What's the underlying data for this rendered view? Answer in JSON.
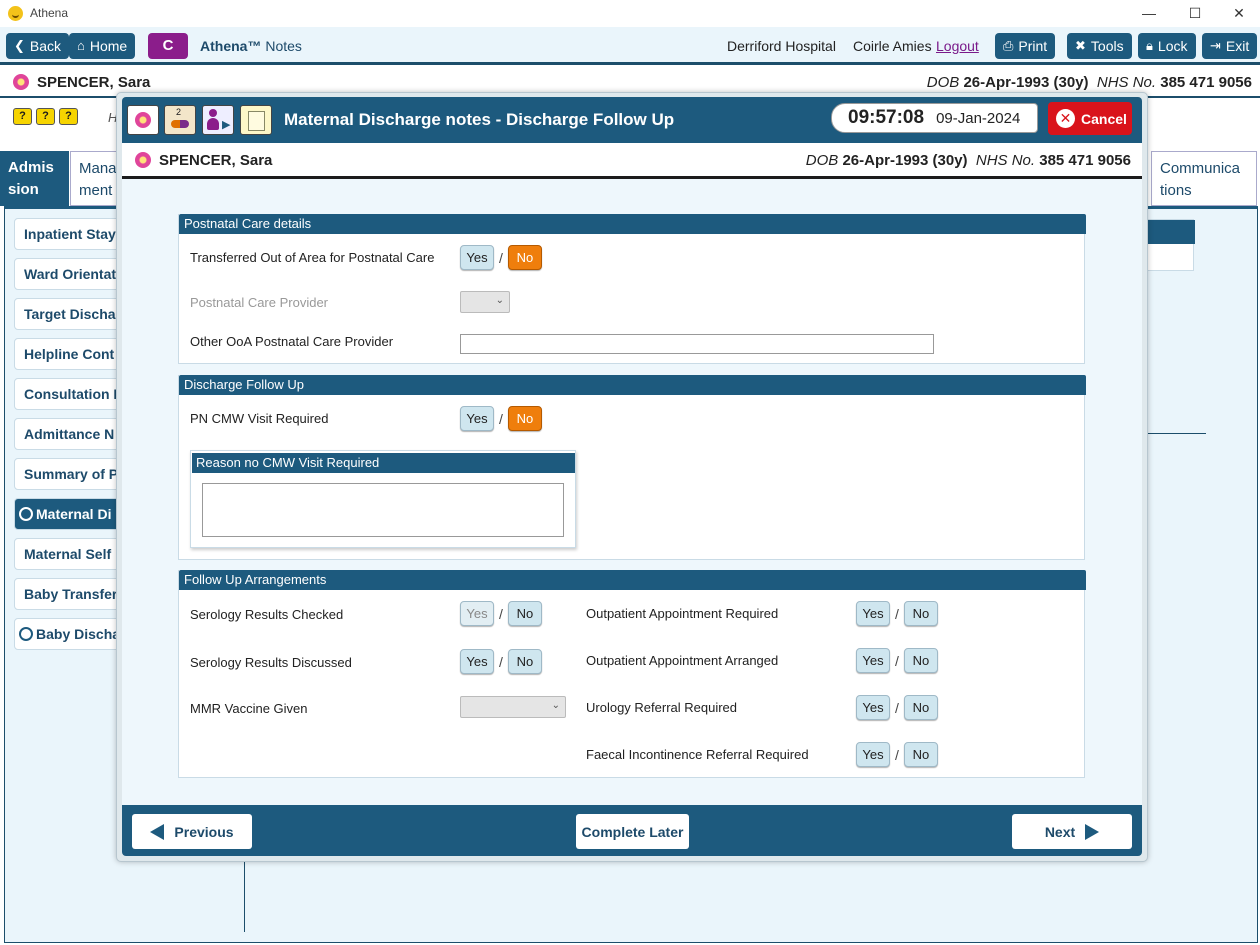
{
  "window": {
    "title": "Athena",
    "minimize": "—",
    "maximize": "☐",
    "close": "✕"
  },
  "toolbar": {
    "back": "Back",
    "home": "Home",
    "c": "C",
    "app_name": "Athena™",
    "app_sub": "Notes",
    "hospital": "Derriford Hospital",
    "user": "Coirle Amies",
    "logout": "Logout",
    "print": "Print",
    "tools": "Tools",
    "lock": "Lock",
    "exit": "Exit"
  },
  "patient": {
    "name": "SPENCER, Sara",
    "dob_label": "DOB",
    "dob": "26-Apr-1993 (30y)",
    "nhs_label": "NHS No.",
    "nhs": "385 471 9056"
  },
  "background": {
    "h_label": "H",
    "tabs": [
      "Admis sion",
      "Mana ment",
      "Communica tions"
    ],
    "nav": [
      "Inpatient Stay",
      "Ward Orientat",
      "Target Dischar",
      "Helpline Cont",
      "Consultation I",
      "Admittance N",
      "Summary of P",
      "Maternal Di",
      "Maternal Self",
      "Baby Transfer",
      "Baby Discha"
    ]
  },
  "modal": {
    "title": "Maternal Discharge notes - Discharge Follow Up",
    "icon_badge": "2",
    "time": "09:57:08",
    "date": "09-Jan-2024",
    "cancel": "Cancel",
    "sections": {
      "postnatal": {
        "header": "Postnatal Care details",
        "transferred": "Transferred Out of Area for Postnatal Care",
        "provider": "Postnatal Care Provider",
        "other_provider": "Other OoA Postnatal Care Provider"
      },
      "followup": {
        "header": "Discharge Follow Up",
        "pn_cmw": "PN CMW Visit Required",
        "reason_header": "Reason no CMW Visit Required"
      },
      "arrangements": {
        "header": "Follow Up Arrangements",
        "serology_checked": "Serology Results Checked",
        "serology_discussed": "Serology Results Discussed",
        "mmr": "MMR Vaccine Given",
        "op_required": "Outpatient Appointment Required",
        "op_arranged": "Outpatient Appointment Arranged",
        "urology": "Urology Referral Required",
        "faecal": "Faecal Incontinence Referral Required"
      }
    },
    "yes": "Yes",
    "no": "No",
    "slash": "/",
    "footer": {
      "previous": "Previous",
      "complete_later": "Complete Later",
      "next": "Next"
    }
  }
}
